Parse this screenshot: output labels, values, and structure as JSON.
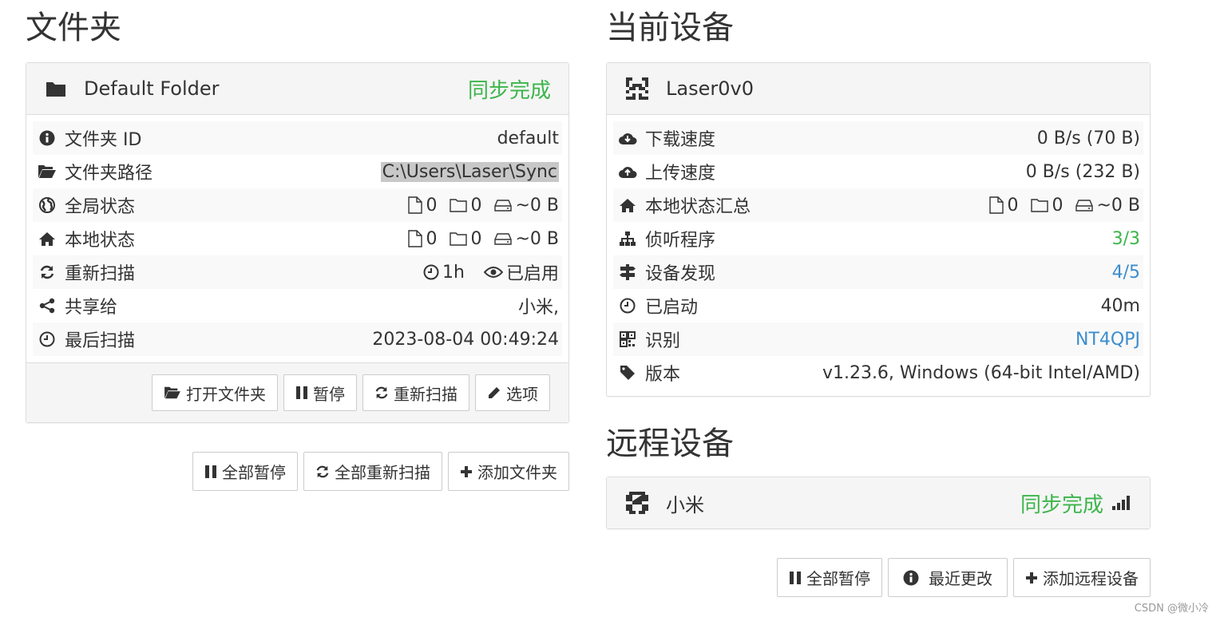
{
  "folders": {
    "title": "文件夹",
    "panel": {
      "name": "Default Folder",
      "status": "同步完成",
      "rows": [
        {
          "label": "文件夹 ID",
          "value": "default",
          "icon": "info-icon"
        },
        {
          "label": "文件夹路径",
          "value": "C:\\Users\\Laser\\Sync",
          "icon": "folder-open-icon"
        },
        {
          "label": "全局状态",
          "files": "0",
          "dirs": "0",
          "size": "~0 B",
          "icon": "globe-icon"
        },
        {
          "label": "本地状态",
          "files": "0",
          "dirs": "0",
          "size": "~0 B",
          "icon": "home-icon"
        },
        {
          "label": "重新扫描",
          "interval": "1h",
          "watch": "已启用",
          "icon": "refresh-icon"
        },
        {
          "label": "共享给",
          "value": "小米,",
          "icon": "share-icon"
        },
        {
          "label": "最后扫描",
          "value": "2023-08-04 00:49:24",
          "icon": "clock-icon"
        }
      ],
      "buttons": {
        "open": "打开文件夹",
        "pause": "暂停",
        "rescan": "重新扫描",
        "options": "选项"
      }
    },
    "actions": {
      "pause_all": "全部暂停",
      "rescan_all": "全部重新扫描",
      "add_folder": "添加文件夹"
    }
  },
  "this_device": {
    "title": "当前设备",
    "name": "Laser0v0",
    "rows": [
      {
        "label": "下载速度",
        "value": "0 B/s (70 B)",
        "icon": "cloud-download-icon"
      },
      {
        "label": "上传速度",
        "value": "0 B/s (232 B)",
        "icon": "cloud-upload-icon"
      },
      {
        "label": "本地状态汇总",
        "files": "0",
        "dirs": "0",
        "size": "~0 B",
        "icon": "home-icon"
      },
      {
        "label": "侦听程序",
        "value": "3/3",
        "icon": "sitemap-icon"
      },
      {
        "label": "设备发现",
        "value": "4/5",
        "icon": "signpost-icon"
      },
      {
        "label": "已启动",
        "value": "40m",
        "icon": "clock-icon"
      },
      {
        "label": "识别",
        "value": "NT4QPJ",
        "icon": "qrcode-icon"
      },
      {
        "label": "版本",
        "value": "v1.23.6, Windows (64-bit Intel/AMD)",
        "icon": "tag-icon"
      }
    ]
  },
  "remote_devices": {
    "title": "远程设备",
    "device_name": "小米",
    "status": "同步完成",
    "actions": {
      "pause_all": "全部暂停",
      "recent_changes": "最近更改",
      "add_device": "添加远程设备"
    }
  },
  "watermark": "CSDN @微小冷",
  "colors": {
    "green": "#3cb54a",
    "blue": "#3c8dce",
    "heading_bg": "#f5f5f5"
  }
}
